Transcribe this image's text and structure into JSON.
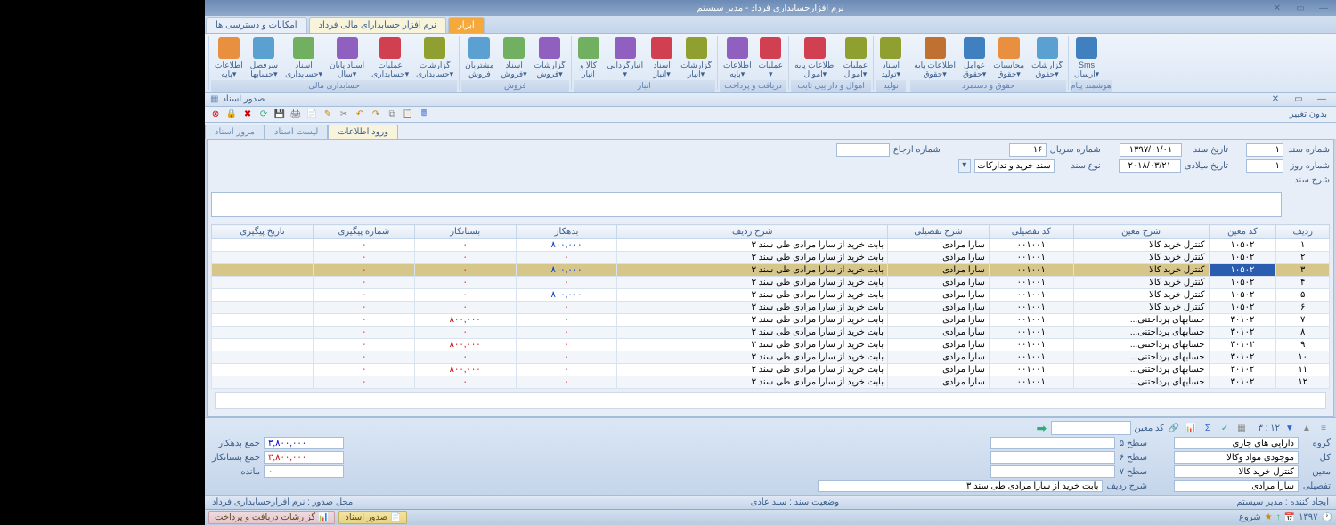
{
  "title": "نرم افزارحسابداری فرداد - مدیر سیستم",
  "mainTabs": {
    "t1": "ابزار",
    "t2": "نرم افزار حسابدارای مالی فرداد",
    "t3": "امکانات و دسترسی ها"
  },
  "ribbon": {
    "g1": {
      "label": "حسابداری مالی",
      "i1": "اطلاعات\n▾پایه",
      "i2": "سرفصل\n▾حسابها",
      "i3": "اسناد\n▾حسابداری",
      "i4": "اسناد پایان\n▾سال",
      "i5": "عملیات\n▾حسابداری",
      "i6": "گزارشات\n▾حسابداری"
    },
    "g2": {
      "label": "فروش",
      "i1": "مشتریان\nفروش",
      "i2": "اسناد\n▾فروش",
      "i3": "گزارشات\n▾فروش"
    },
    "g3": {
      "label": "انبار",
      "i1": "کالا و\nانبار",
      "i2": "انبارگردانی\n▾",
      "i3": "اسناد\n▾انبار",
      "i4": "گزارشات\n▾انبار"
    },
    "g4": {
      "label": "دریافت و پرداخت",
      "i1": "اطلاعات\n▾پایه",
      "i2": "عملیات\n▾"
    },
    "g5": {
      "label": "اموال و داراییی ثابت",
      "i1": "اطلاعات پایه\n▾اموال",
      "i2": "عملیات\n▾اموال"
    },
    "g6": {
      "label": "تولید",
      "i1": "اسناد\n▾تولید"
    },
    "g7": {
      "label": "حقوق و دستمزد",
      "i1": "اطلاعات پایه\n▾حقوق",
      "i2": "عوامل\n▾حقوق",
      "i3": "محاسبات\n▾حقوق",
      "i4": "گزارشات\n▾حقوق"
    },
    "g8": {
      "label": "هوشمند پیام",
      "i1": "Sms\n▾ارسال"
    }
  },
  "docTitle": "صدور اسناد",
  "statusText": "بدون تغییر",
  "innerTabs": {
    "t1": "ورود اطلاعات",
    "t2": "لیست اسناد",
    "t3": "مرور اسناد"
  },
  "form": {
    "docNo": {
      "lbl": "شماره سند",
      "val": "۱"
    },
    "docDate": {
      "lbl": "تاریخ سند",
      "val": "۱۳۹۷/۰۱/۰۱"
    },
    "serial": {
      "lbl": "شماره سریال",
      "val": "۱۶"
    },
    "ref": {
      "lbl": "شماره ارجاع",
      "val": ""
    },
    "dayNo": {
      "lbl": "شماره روز",
      "val": "۱"
    },
    "gregDate": {
      "lbl": "تاریخ میلادی",
      "val": "۲۰۱۸/۰۳/۲۱"
    },
    "docType": {
      "lbl": "نوع سند",
      "val": "سند خرید و تدارکات"
    },
    "desc": {
      "lbl": "شرح سند"
    }
  },
  "gridH": {
    "row": "ردیف",
    "moCode": "کد معین",
    "moDesc": "شرح معین",
    "tafCode": "کد تفصیلی",
    "tafDesc": "شرح تفصیلی",
    "rowDesc": "شرح ردیف",
    "debit": "بدهکار",
    "credit": "بستانکار",
    "trackNo": "شماره پیگیری",
    "trackDate": "تاریخ پیگیری"
  },
  "rows": [
    {
      "r": "۱",
      "mc": "۱۰۵۰۲",
      "md": "کنترل خرید کالا",
      "tc": "۰۰۱۰۰۱",
      "td": "سارا مرادی",
      "rd": "بابت خرید از  سارا مرادی طی سند   ۳",
      "db": "۸۰۰,۰۰۰",
      "cr": "۰",
      "alt": false
    },
    {
      "r": "۲",
      "mc": "۱۰۵۰۲",
      "md": "کنترل خرید کالا",
      "tc": "۰۰۱۰۰۱",
      "td": "سارا مرادی",
      "rd": "بابت خرید از  سارا مرادی طی سند   ۳",
      "db": "۰",
      "cr": "۰",
      "alt": true
    },
    {
      "r": "۳",
      "mc": "۱۰۵۰۲",
      "md": "کنترل خرید کالا",
      "tc": "۰۰۱۰۰۱",
      "td": "سارا مرادی",
      "rd": "بابت خرید از  سارا مرادی طی سند   ۳",
      "db": "۸۰۰,۰۰۰",
      "cr": "۰",
      "sel": true
    },
    {
      "r": "۴",
      "mc": "۱۰۵۰۲",
      "md": "کنترل خرید کالا",
      "tc": "۰۰۱۰۰۱",
      "td": "سارا مرادی",
      "rd": "بابت خرید از  سارا مرادی طی سند   ۳",
      "db": "۰",
      "cr": "۰",
      "alt": true
    },
    {
      "r": "۵",
      "mc": "۱۰۵۰۲",
      "md": "کنترل خرید کالا",
      "tc": "۰۰۱۰۰۱",
      "td": "سارا مرادی",
      "rd": "بابت خرید از  سارا مرادی طی سند   ۳",
      "db": "۸۰۰,۰۰۰",
      "cr": "۰",
      "alt": false
    },
    {
      "r": "۶",
      "mc": "۱۰۵۰۲",
      "md": "کنترل خرید کالا",
      "tc": "۰۰۱۰۰۱",
      "td": "سارا مرادی",
      "rd": "بابت خرید از  سارا مرادی طی سند   ۳",
      "db": "۰",
      "cr": "۰",
      "alt": true
    },
    {
      "r": "۷",
      "mc": "۳۰۱۰۲",
      "md": "حسابهای پرداختنی...",
      "tc": "۰۰۱۰۰۱",
      "td": "سارا مرادی",
      "rd": "بابت خرید از  سارا مرادی طی سند   ۳",
      "db": "۰",
      "cr": "۸۰۰,۰۰۰",
      "alt": false
    },
    {
      "r": "۸",
      "mc": "۳۰۱۰۲",
      "md": "حسابهای پرداختنی...",
      "tc": "۰۰۱۰۰۱",
      "td": "سارا مرادی",
      "rd": "بابت خرید از  سارا مرادی طی سند   ۳",
      "db": "۰",
      "cr": "۰",
      "alt": true
    },
    {
      "r": "۹",
      "mc": "۳۰۱۰۲",
      "md": "حسابهای پرداختنی...",
      "tc": "۰۰۱۰۰۱",
      "td": "سارا مرادی",
      "rd": "بابت خرید از  سارا مرادی طی سند   ۳",
      "db": "۰",
      "cr": "۸۰۰,۰۰۰",
      "alt": false
    },
    {
      "r": "۱۰",
      "mc": "۳۰۱۰۲",
      "md": "حسابهای پرداختنی...",
      "tc": "۰۰۱۰۰۱",
      "td": "سارا مرادی",
      "rd": "بابت خرید از  سارا مرادی طی سند   ۳",
      "db": "۰",
      "cr": "۰",
      "alt": true
    },
    {
      "r": "۱۱",
      "mc": "۳۰۱۰۲",
      "md": "حسابهای پرداختنی...",
      "tc": "۰۰۱۰۰۱",
      "td": "سارا مرادی",
      "rd": "بابت خرید از  سارا مرادی طی سند   ۳",
      "db": "۰",
      "cr": "۸۰۰,۰۰۰",
      "alt": false
    },
    {
      "r": "۱۲",
      "mc": "۳۰۱۰۲",
      "md": "حسابهای پرداختنی...",
      "tc": "۰۰۱۰۰۱",
      "td": "سارا مرادی",
      "rd": "بابت خرید از  سارا مرادی طی سند   ۳",
      "db": "۰",
      "cr": "۰",
      "alt": true
    }
  ],
  "footer": {
    "codeLbl": "کد معین",
    "time": "۱۲ : ۳",
    "group": {
      "lbl": "گروه",
      "val": "دارایی های جاری"
    },
    "kol": {
      "lbl": "کل",
      "val": "موجودی مواد وکالا"
    },
    "moein": {
      "lbl": "معین",
      "val": "کنترل خرید کالا"
    },
    "tafsili": {
      "lbl": "تفصیلی",
      "val": "سارا مرادی"
    },
    "l5": {
      "lbl": "سطح ۵",
      "val": ""
    },
    "l6": {
      "lbl": "سطح ۶",
      "val": ""
    },
    "l7": {
      "lbl": "سطح ۷",
      "val": ""
    },
    "rowDesc": {
      "lbl": "شرح ردیف",
      "val": "بابت خرید از  سارا مرادی طی سند   ۳"
    },
    "sumDebit": {
      "lbl": "جمع بدهکار",
      "val": "۳,۸۰۰,۰۰۰"
    },
    "sumCredit": {
      "lbl": "جمع بستانکار",
      "val": "۳,۸۰۰,۰۰۰"
    },
    "balance": {
      "lbl": "مانده",
      "val": "۰"
    }
  },
  "status": {
    "creator": "ایجاد کننده : مدیر سیستم",
    "docStatus": "وضعیت سند : سند عادی",
    "location": "محل صدور : نرم افزارحسابداری فرداد"
  },
  "taskbar": {
    "t1": "صدور اسناد",
    "t2": "گزارشات دریافت و پرداخت",
    "year": "۱۳۹۷",
    "start": "شروع"
  }
}
